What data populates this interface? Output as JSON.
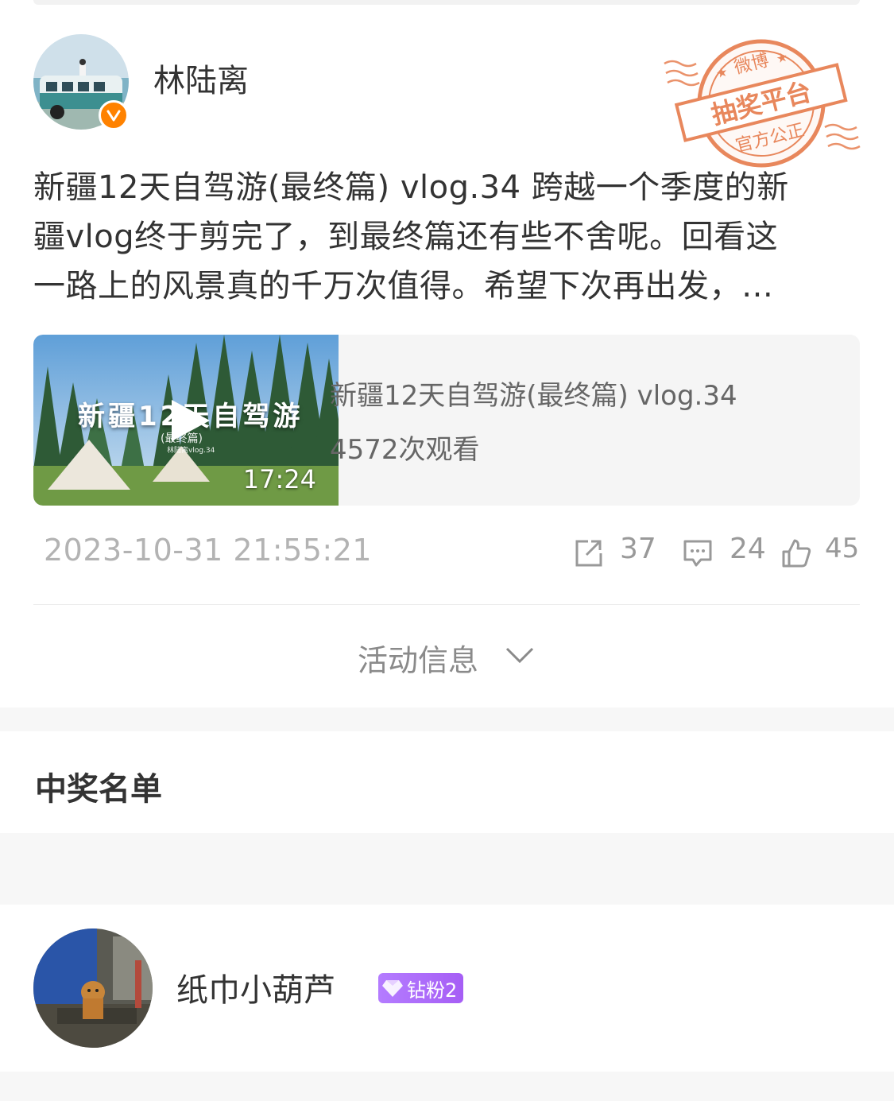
{
  "post": {
    "author_name": "林陆离",
    "stamp": {
      "top_text": "微博",
      "main_text": "抽奖平台",
      "bottom_text": "官方公正"
    },
    "text_lines": [
      "新疆12天自驾游(最终篇) vlog.34 跨越一个季度的新",
      "疆vlog终于剪完了，到最终篇还有些不舍呢。回看这",
      "一路上的风景真的千万次值得。希望下次再出发，…"
    ],
    "video": {
      "thumb_title": "新疆12天自驾游",
      "thumb_subtitle": "(最终篇)",
      "thumb_credit": "林陆离vlog.34",
      "duration": "17:24",
      "title": "新疆12天自驾游(最终篇) vlog.34",
      "views": "4572次观看"
    },
    "timestamp": "2023-10-31 21:55:21",
    "shares": "37",
    "comments": "24",
    "likes": "45"
  },
  "activity_toggle": "活动信息",
  "winners": {
    "title": "中奖名单",
    "items": [
      {
        "name": "纸巾小葫芦",
        "badge": "钻粉2"
      }
    ]
  },
  "colors": {
    "verified": "#ff8200",
    "stamp": "#e8875c",
    "badge": "#a65ef5"
  }
}
